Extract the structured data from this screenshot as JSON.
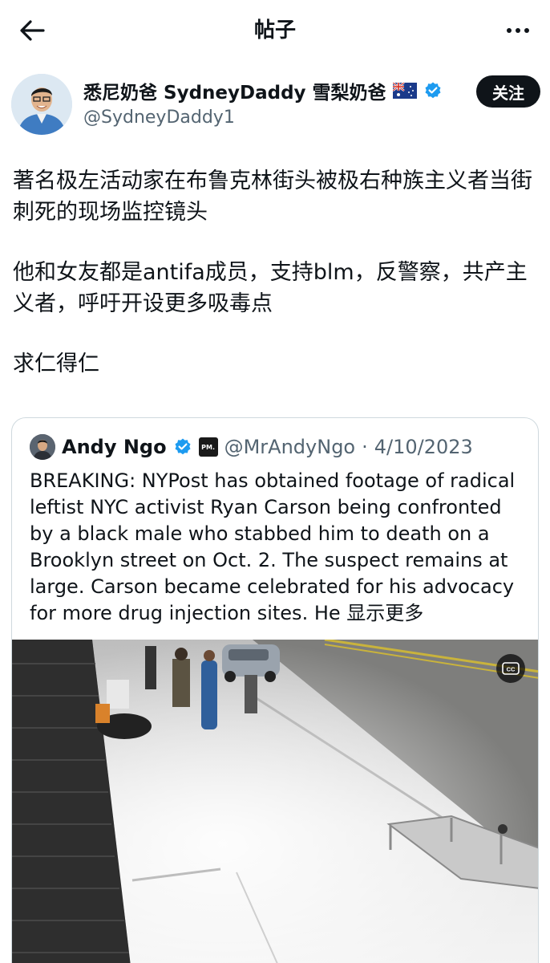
{
  "header": {
    "title": "帖子"
  },
  "author": {
    "name": "悉尼奶爸 SydneyDaddy 雪梨奶爸",
    "handle": "@SydneyDaddy1",
    "follow_label": "关注"
  },
  "post": {
    "paragraphs": [
      "著名极左活动家在布鲁克林街头被极右种族主义者当街刺死的现场监控镜头",
      "他和女友都是antifa成员，支持blm，反警察，共产主义者，呼吁开设更多吸毒点",
      "求仁得仁"
    ]
  },
  "quote": {
    "name": "Andy Ngo",
    "badge": "PM.",
    "handle": "@MrAndyNgo",
    "separator": "·",
    "date": "4/10/2023",
    "text": "BREAKING: NYPost has obtained footage of radical leftist NYC activist Ryan Carson being confronted by a black male who stabbed him to death on a Brooklyn street on Oct. 2. The suspect remains at large. Carson became celebrated for his advocacy for more drug injection sites. He",
    "show_more": "显示更多",
    "cc_label": "CC"
  },
  "colors": {
    "text": "#0f1419",
    "secondary": "#536471",
    "verified": "#1d9bf0",
    "border": "#cfd9de"
  },
  "icons": {
    "back": "arrow-left-icon",
    "more": "more-horizontal-icon",
    "verified": "verified-badge-icon",
    "flag": "australia-flag-icon"
  }
}
